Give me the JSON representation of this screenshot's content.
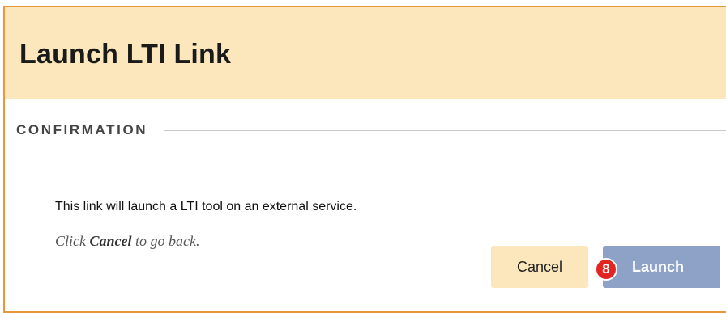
{
  "dialog": {
    "title": "Launch LTI Link",
    "section_label": "CONFIRMATION",
    "message": "This link will launch a LTI tool on an external service.",
    "hint": {
      "prefix": "Click ",
      "action": "Cancel",
      "suffix": " to go back."
    },
    "buttons": {
      "cancel_label": "Cancel",
      "launch_label": "Launch"
    },
    "step_badge": "8"
  },
  "colors": {
    "frame_border": "#e8973b",
    "header_bg": "#fbe7bb",
    "cancel_bg": "#fbe7bb",
    "launch_bg": "#8ea1c6",
    "badge_bg": "#e32420"
  }
}
